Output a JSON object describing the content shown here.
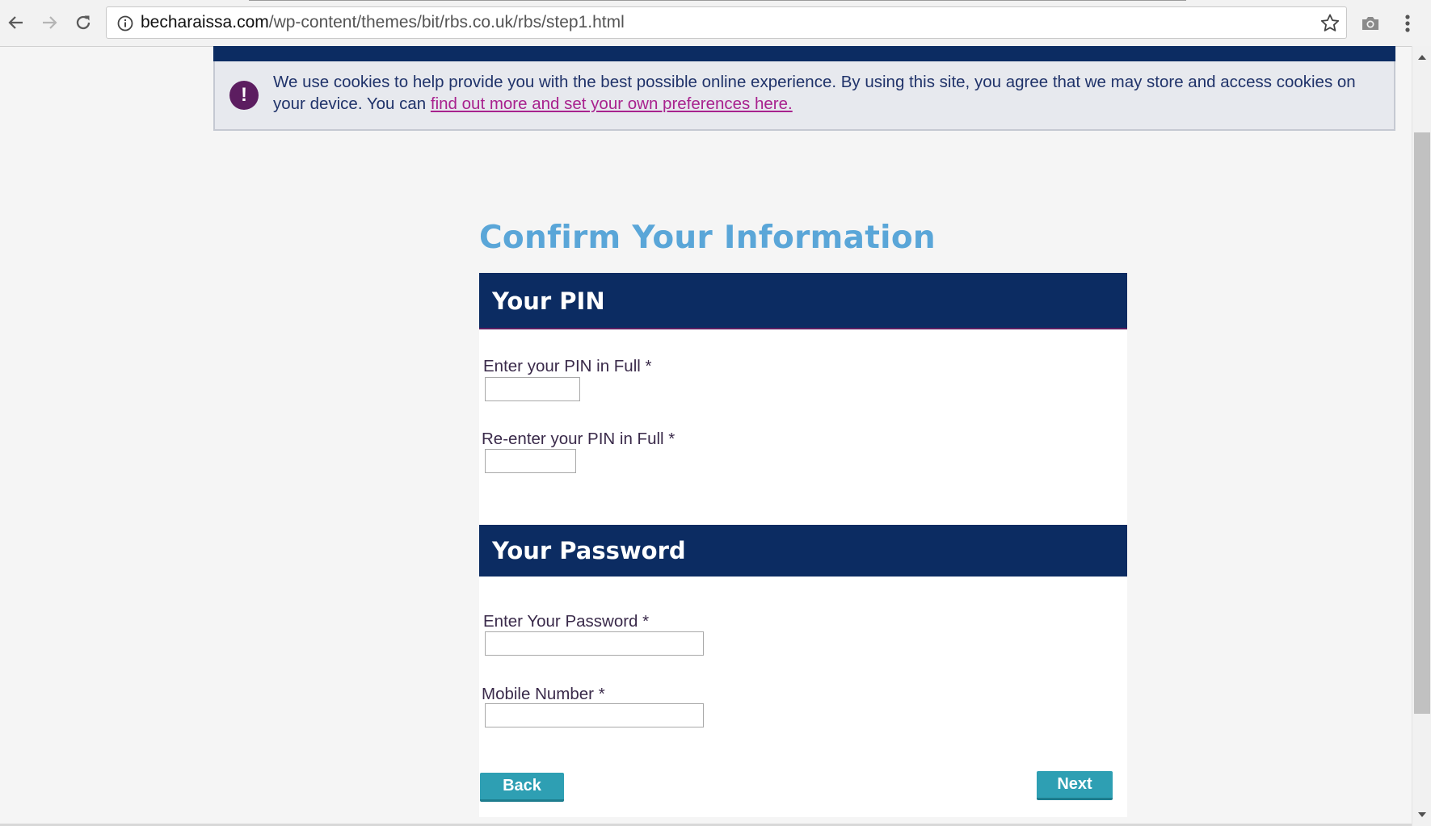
{
  "browser": {
    "url_host": "becharaissa.com",
    "url_path": "/wp-content/themes/bit/rbs.co.uk/rbs/step1.html"
  },
  "cookie_banner": {
    "message": "We use cookies to help provide you with the best possible online experience.  By using this site, you agree that we may store and access cookies on your device. You can ",
    "link_text": "find out more and set your own preferences here.",
    "icon": "exclamation-icon",
    "icon_color": "#5c1d60"
  },
  "page": {
    "title": "Confirm Your Information",
    "title_color": "#5aa6d8",
    "header_color": "#0c2c62",
    "button_color": "#2e9fb3"
  },
  "pin_section": {
    "heading": "Your PIN",
    "pin_label": "Enter your PIN in Full *",
    "pin_value": "",
    "reenter_label": "Re-enter your PIN in Full *",
    "reenter_value": ""
  },
  "password_section": {
    "heading": "Your Password",
    "password_label": "Enter Your Password *",
    "password_value": "",
    "mobile_label": "Mobile Number *",
    "mobile_value": ""
  },
  "buttons": {
    "back": "Back",
    "next": "Next"
  }
}
